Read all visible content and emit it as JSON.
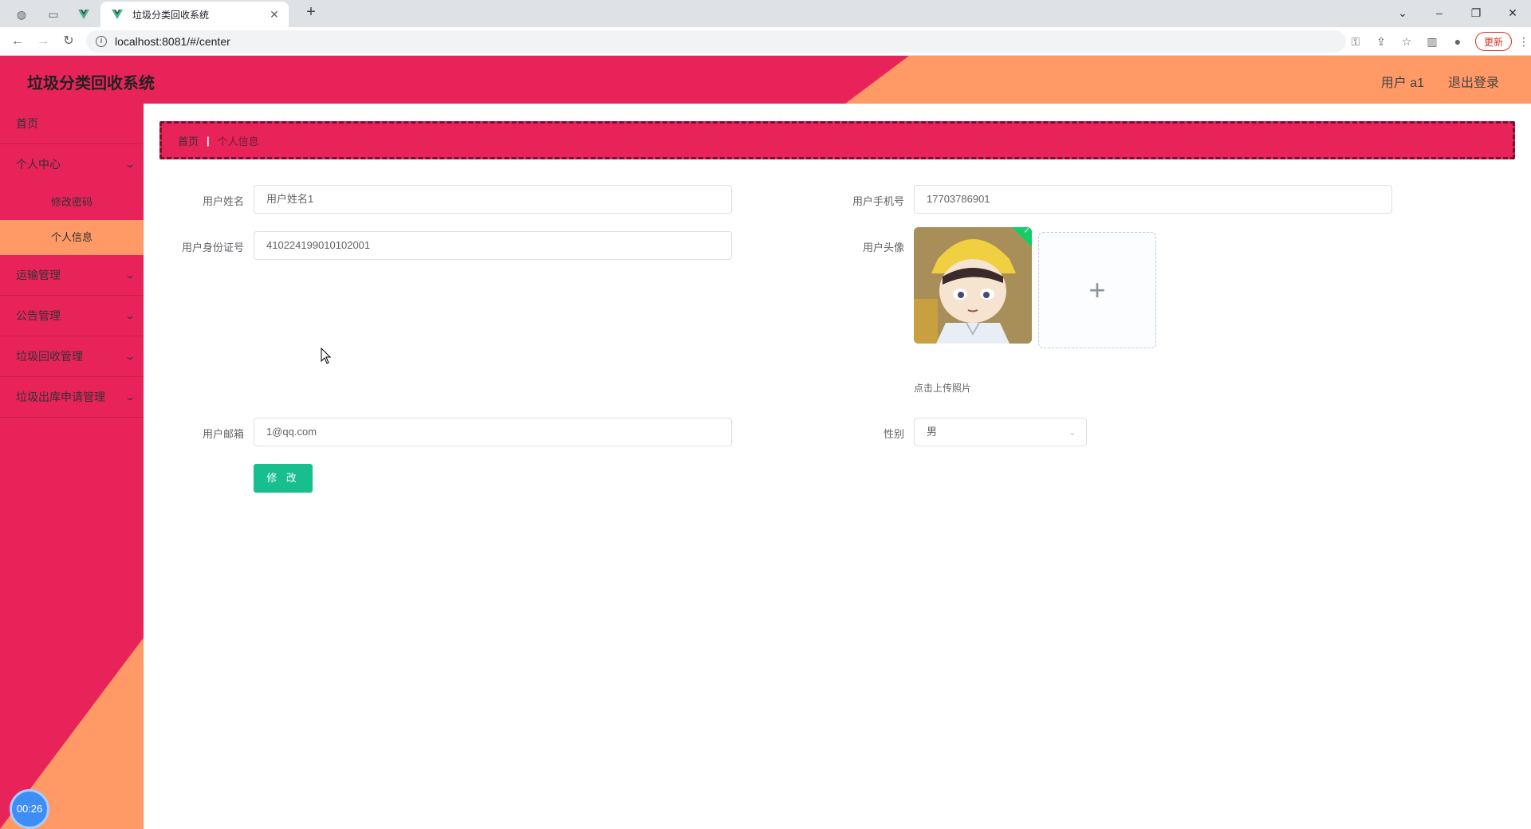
{
  "browser": {
    "active_tab_title": "垃圾分类回收系统",
    "url": "localhost:8081/#/center",
    "update_label": "更新"
  },
  "header": {
    "app_title": "垃圾分类回收系统",
    "user_label": "用户 a1",
    "logout_label": "退出登录"
  },
  "sidebar": {
    "items": [
      {
        "label": "首页"
      },
      {
        "label": "个人中心",
        "children": [
          "修改密码",
          "个人信息"
        ],
        "active_child": "个人信息"
      },
      {
        "label": "运输管理"
      },
      {
        "label": "公告管理"
      },
      {
        "label": "垃圾回收管理"
      },
      {
        "label": "垃圾出库申请管理"
      }
    ]
  },
  "breadcrumb": {
    "home": "首页",
    "current": "个人信息"
  },
  "form": {
    "name_label": "用户姓名",
    "name_value": "用户姓名1",
    "phone_label": "用户手机号",
    "phone_value": "17703786901",
    "idcard_label": "用户身份证号",
    "idcard_value": "410224199010102001",
    "avatar_label": "用户头像",
    "upload_tip": "点击上传照片",
    "email_label": "用户邮箱",
    "email_value": "1@qq.com",
    "gender_label": "性别",
    "gender_value": "男",
    "submit_label": "修 改"
  },
  "timer": "00:26",
  "colors": {
    "primary": "#e8235a",
    "accent": "#ff9966",
    "button": "#16bf8d"
  }
}
